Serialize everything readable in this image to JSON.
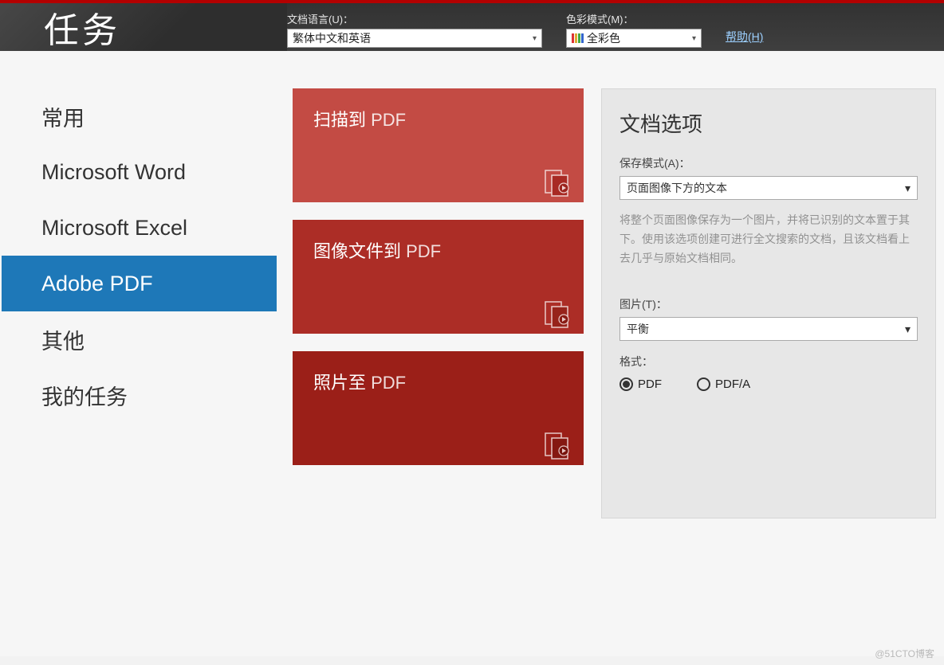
{
  "header": {
    "title": "任务",
    "lang_label": "文档语言(U)：",
    "lang_value": "繁体中文和英语",
    "color_label": "色彩模式(M)：",
    "color_value": "全彩色",
    "help": "帮助(H)"
  },
  "sidebar": {
    "items": [
      {
        "label": "常用"
      },
      {
        "label": "Microsoft Word"
      },
      {
        "label": "Microsoft Excel"
      },
      {
        "label": "Adobe PDF"
      },
      {
        "label": "其他"
      },
      {
        "label": "我的任务"
      }
    ],
    "active_index": 3
  },
  "cards": [
    {
      "prefix": "扫描到 ",
      "suffix": "PDF"
    },
    {
      "prefix": "图像文件到 ",
      "suffix": "PDF"
    },
    {
      "prefix": "照片至 ",
      "suffix": "PDF"
    }
  ],
  "right": {
    "title": "文档选项",
    "save_mode_label": "保存模式(A)：",
    "save_mode_value": "页面图像下方的文本",
    "description": "将整个页面图像保存为一个图片，并将已识别的文本置于其下。使用该选项创建可进行全文搜索的文档，且该文档看上去几乎与原始文档相同。",
    "image_label": "图片(T)：",
    "image_value": "平衡",
    "format_label": "格式：",
    "radio_pdf": "PDF",
    "radio_pdfa": "PDF/A"
  },
  "watermark": "@51CTO博客"
}
